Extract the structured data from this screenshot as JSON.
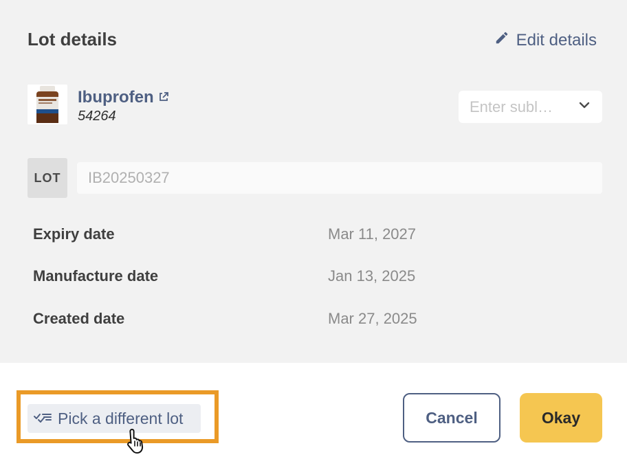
{
  "header": {
    "title": "Lot details",
    "edit_label": "Edit details"
  },
  "product": {
    "name": "Ibuprofen",
    "code": "54264"
  },
  "sublot": {
    "placeholder": "Enter subl…"
  },
  "lot": {
    "badge": "LOT",
    "value": "IB20250327"
  },
  "details": [
    {
      "label": "Expiry date",
      "value": "Mar 11, 2027"
    },
    {
      "label": "Manufacture date",
      "value": "Jan 13, 2025"
    },
    {
      "label": "Created date",
      "value": "Mar 27, 2025"
    }
  ],
  "footer": {
    "pick_label": "Pick a different lot",
    "cancel_label": "Cancel",
    "okay_label": "Okay"
  },
  "colors": {
    "accent": "#4e5f82",
    "primary_button": "#f5c651",
    "highlight": "#ea9a27",
    "panel_bg": "#f2f2f2"
  },
  "icons": [
    "pencil-icon",
    "external-link-icon",
    "chevron-down-icon",
    "checklist-icon",
    "hand-pointer-icon"
  ]
}
